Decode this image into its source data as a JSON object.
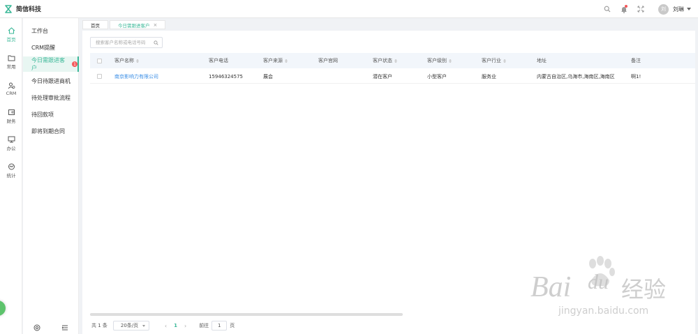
{
  "app": {
    "brand": "简信科技"
  },
  "user": {
    "avatar_text": "刘",
    "name": "刘琳"
  },
  "rail": [
    {
      "label": "首页",
      "icon": "home-icon",
      "active": true
    },
    {
      "label": "常用",
      "icon": "folder-icon"
    },
    {
      "label": "CRM",
      "icon": "user-icon"
    },
    {
      "label": "财务",
      "icon": "wallet-icon"
    },
    {
      "label": "办公",
      "icon": "monitor-icon"
    },
    {
      "label": "统计",
      "icon": "chart-icon"
    }
  ],
  "menu": [
    {
      "label": "工作台"
    },
    {
      "label": "CRM提醒"
    },
    {
      "label": "今日需跟进客户",
      "badge": "1",
      "active": true
    },
    {
      "label": "今日待跟进商机"
    },
    {
      "label": "待处理审批流程"
    },
    {
      "label": "待回款项"
    },
    {
      "label": "即将到期合同"
    }
  ],
  "tabs": [
    {
      "label": "首页"
    },
    {
      "label": "今日需跟进客户",
      "active": true
    }
  ],
  "search": {
    "placeholder": "搜索客户名称或电话号码"
  },
  "table": {
    "columns": [
      "客户名称",
      "客户电话",
      "客户来源",
      "客户官网",
      "客户状态",
      "客户级别",
      "客户行业",
      "地址",
      "备注"
    ],
    "sortable": [
      true,
      false,
      true,
      false,
      true,
      true,
      true,
      false,
      false
    ],
    "rows": [
      [
        "南京影响力有限公司",
        "15946324575",
        "展会",
        "",
        "潜在客户",
        "小型客户",
        "服务业",
        "内蒙古自治区,乌海市,海南区,海南区",
        "啊1!"
      ]
    ]
  },
  "pager": {
    "total": "共 1 条",
    "page_size": "20条/页",
    "prev": "‹",
    "current": "1",
    "next": "›",
    "goto_label": "前往",
    "goto_value": "1",
    "page_unit": "页"
  },
  "watermark": {
    "main": "Bai",
    "mid": "du",
    "cn": "经验",
    "url": "jingyan.baidu.com"
  }
}
